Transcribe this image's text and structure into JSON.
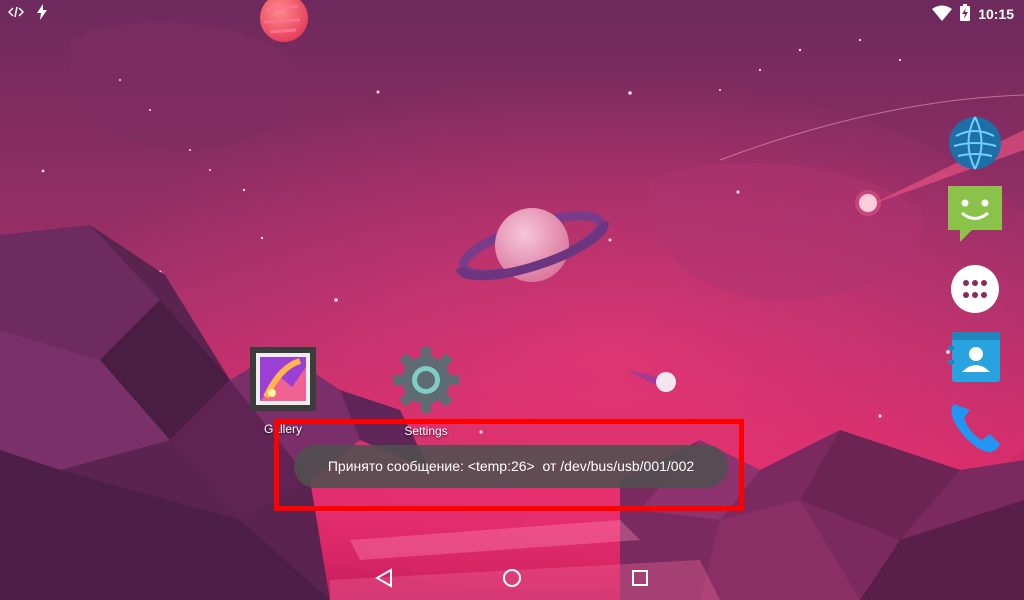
{
  "status_bar": {
    "time": "10:15",
    "icons_left": [
      "code-icon",
      "flash-icon"
    ],
    "icons_right": [
      "wifi-icon",
      "battery-icon"
    ]
  },
  "home_screen": {
    "apps": [
      {
        "label": "Gallery",
        "icon": "gallery-icon"
      },
      {
        "label": "Settings",
        "icon": "gear-icon"
      }
    ],
    "dock": [
      "browser-globe-icon",
      "messenger-icon",
      "all-apps-icon",
      "contacts-icon",
      "phone-icon"
    ]
  },
  "toast": {
    "message": "Принято сообщение: <temp:26>  от /dev/bus/usb/001/002"
  },
  "colors": {
    "highlight": "#ff0000",
    "toast_bg": "#505050",
    "messenger_green": "#8bc34a",
    "contacts_blue": "#29a3e0",
    "phone_blue": "#2196f3"
  },
  "nav_bar": {
    "buttons": [
      "back-icon",
      "home-icon",
      "recents-icon"
    ]
  }
}
